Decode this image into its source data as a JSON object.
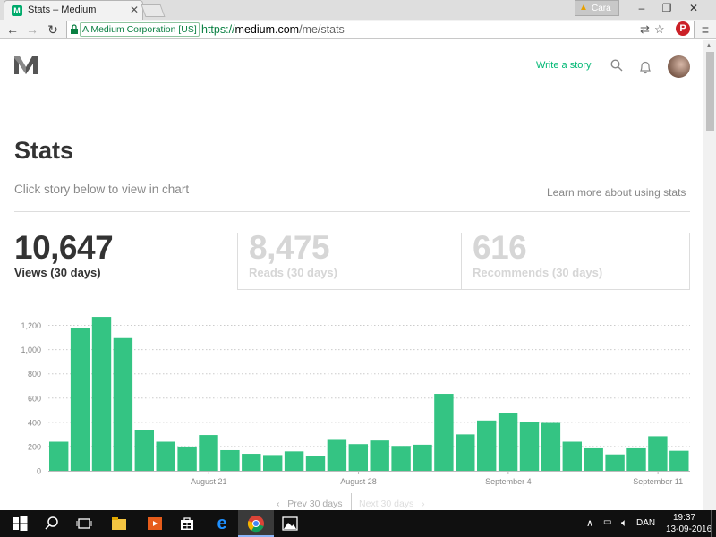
{
  "browser": {
    "tab_title": "Stats – Medium",
    "tab_favicon": "M",
    "user_name": "Cara",
    "ev_label": "A Medium Corporation [US]",
    "url_scheme": "https://",
    "url_host": "medium.com",
    "url_path": "/me/stats"
  },
  "header": {
    "write_story": "Write a story"
  },
  "page": {
    "title": "Stats",
    "subtitle": "Click story below to view in chart",
    "learn_more": "Learn more about using stats"
  },
  "stats": [
    {
      "value": "10,647",
      "label": "Views (30 days)",
      "active": true
    },
    {
      "value": "8,475",
      "label": "Reads (30 days)",
      "active": false
    },
    {
      "value": "616",
      "label": "Recommends (30 days)",
      "active": false
    }
  ],
  "pager": {
    "prev": "Prev 30 days",
    "next": "Next 30 days"
  },
  "taskbar": {
    "language": "DAN",
    "time": "19:37",
    "date": "13-09-2016"
  },
  "colors": {
    "bar": "#34c483",
    "accent": "#02b875"
  },
  "chart_data": {
    "type": "bar",
    "metric": "Views",
    "x_tick_labels": [
      {
        "index": 7,
        "label": "August 21"
      },
      {
        "index": 14,
        "label": "August 28"
      },
      {
        "index": 21,
        "label": "September 4"
      },
      {
        "index": 28,
        "label": "September 11"
      }
    ],
    "values": [
      240,
      1175,
      1270,
      1095,
      335,
      240,
      200,
      295,
      170,
      140,
      130,
      160,
      125,
      255,
      220,
      250,
      205,
      215,
      635,
      300,
      415,
      475,
      400,
      395,
      240,
      185,
      135,
      185,
      285,
      165
    ],
    "ylim": [
      0,
      1300
    ],
    "y_ticks": [
      0,
      200,
      400,
      600,
      800,
      1000,
      1200
    ],
    "y_tick_labels": [
      "0",
      "200",
      "400",
      "600",
      "800",
      "1,000",
      "1,200"
    ],
    "grid": true
  }
}
